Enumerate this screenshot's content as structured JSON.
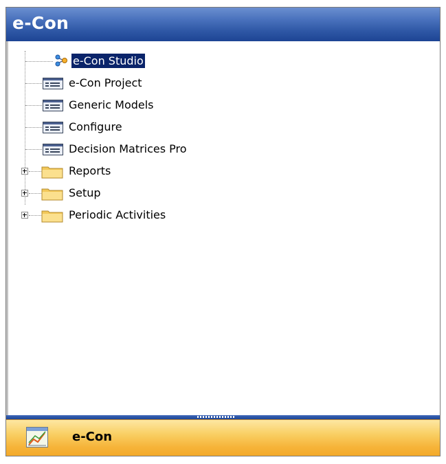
{
  "header": {
    "title": "e-Con"
  },
  "tree": {
    "items": [
      {
        "label": "e-Con Studio",
        "icon": "network-node-icon",
        "selected": true
      },
      {
        "label": "e-Con Project",
        "icon": "form-list-icon"
      },
      {
        "label": "Generic Models",
        "icon": "form-list-icon"
      },
      {
        "label": "Configure",
        "icon": "form-list-icon"
      },
      {
        "label": "Decision Matrices Pro",
        "icon": "form-list-icon"
      },
      {
        "label": "Reports",
        "icon": "folder-icon",
        "expandable": true
      },
      {
        "label": "Setup",
        "icon": "folder-icon",
        "expandable": true
      },
      {
        "label": "Periodic Activities",
        "icon": "folder-icon",
        "expandable": true
      }
    ]
  },
  "nav_button": {
    "label": "e-Con",
    "icon": "chart-module-icon"
  },
  "colors": {
    "title_bar": "#2e57a5",
    "nav_button": "#f6b43a",
    "selection": "#0a246a"
  }
}
